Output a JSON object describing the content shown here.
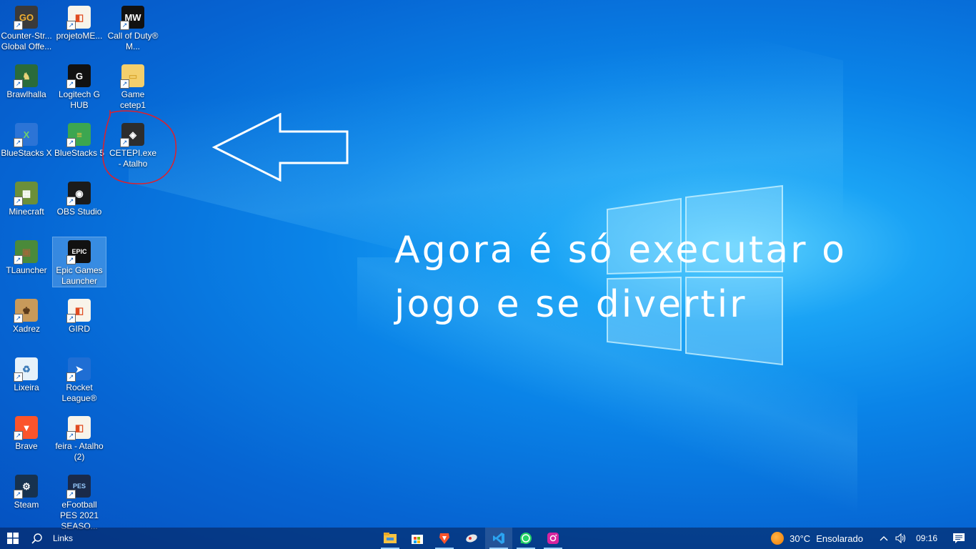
{
  "desktop": {
    "icons": [
      {
        "label": "Counter-Str... Global Offe...",
        "icon": "csgo-icon"
      },
      {
        "label": "projetoME...",
        "icon": "html-file-icon"
      },
      {
        "label": "Call of Duty® M...",
        "icon": "call-of-duty-icon"
      },
      {
        "label": "Brawlhalla",
        "icon": "brawlhalla-icon"
      },
      {
        "label": "Logitech G HUB",
        "icon": "logitech-icon"
      },
      {
        "label": "Game cetep1",
        "icon": "folder-icon"
      },
      {
        "label": "BlueStacks X",
        "icon": "bluestacks-x-icon"
      },
      {
        "label": "BlueStacks 5",
        "icon": "bluestacks-icon"
      },
      {
        "label": "CETEPI.exe - Atalho",
        "icon": "unity-icon"
      },
      {
        "label": "Minecraft",
        "icon": "minecraft-icon"
      },
      {
        "label": "OBS Studio",
        "icon": "obs-icon"
      },
      {
        "label": "TLauncher",
        "icon": "tlauncher-icon"
      },
      {
        "label": "Epic Games Launcher",
        "icon": "epic-games-icon"
      },
      {
        "label": "Xadrez",
        "icon": "chess-icon"
      },
      {
        "label": "GIRD",
        "icon": "html-file-icon"
      },
      {
        "label": "Lixeira",
        "icon": "recycle-bin-icon"
      },
      {
        "label": "Rocket League®",
        "icon": "rocket-league-icon"
      },
      {
        "label": "Brave",
        "icon": "brave-icon"
      },
      {
        "label": "feira - Atalho (2)",
        "icon": "html-file-icon"
      },
      {
        "label": "Steam",
        "icon": "steam-icon"
      },
      {
        "label": "eFootball PES 2021 SEASO...",
        "icon": "pes-icon"
      }
    ]
  },
  "overlay": {
    "line1": "Agora é só executar o",
    "line2": "jogo e se divertir"
  },
  "taskbar": {
    "search_label": "Links",
    "pinned": [
      "file-explorer-icon",
      "microsoft-store-icon",
      "brave-icon",
      "app-icon",
      "vscode-icon",
      "whatsapp-icon",
      "instagram-icon"
    ],
    "weather_temp": "30°C",
    "weather_desc": "Ensolarado",
    "clock": "09:16"
  },
  "colors": {
    "annotation_red": "#e0202a",
    "accent_blue": "#0a84e8"
  }
}
